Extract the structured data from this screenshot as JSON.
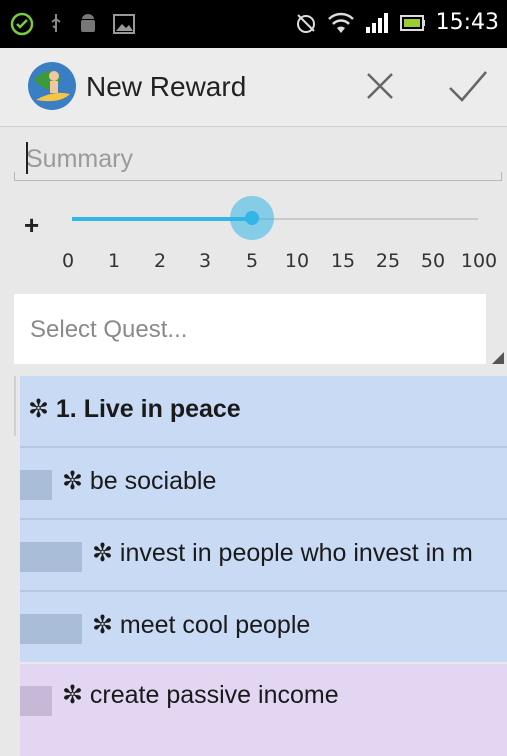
{
  "status_bar": {
    "time": "15:43",
    "icons": [
      "check-circle-icon",
      "usb-icon",
      "android-icon",
      "image-icon",
      "alarm-off-icon",
      "wifi-icon",
      "signal-icon",
      "battery-icon"
    ]
  },
  "action_bar": {
    "title": "New Reward",
    "cancel_icon": "close-icon",
    "done_icon": "check-icon"
  },
  "summary": {
    "placeholder": "Summary",
    "value": ""
  },
  "slider": {
    "prefix": "+",
    "ticks": [
      "0",
      "1",
      "2",
      "3",
      "5",
      "10",
      "15",
      "25",
      "50",
      "100"
    ],
    "selected_value": "5"
  },
  "quest_select": {
    "placeholder": "Select Quest..."
  },
  "dropdown": {
    "items": [
      {
        "label": "✼ 1. Live in peace",
        "bold": true,
        "level": 0,
        "color": "#c9daf5"
      },
      {
        "label": "✼ be sociable",
        "bold": false,
        "level": 1,
        "color": "#c9daf5"
      },
      {
        "label": "✼ invest in people who invest in m",
        "bold": false,
        "level": 2,
        "color": "#c9daf5"
      },
      {
        "label": "✼ meet cool people",
        "bold": false,
        "level": 2,
        "color": "#c9daf5"
      },
      {
        "label": "✼ create passive income",
        "bold": false,
        "level": 1,
        "color": "#e2d6f3"
      }
    ]
  },
  "colors": {
    "accent": "#33b5e5",
    "list_blue": "#c9daf5",
    "list_purple": "#e2d6f3",
    "indent_blue": "#a9bdd8",
    "indent_purple": "#c8b8d8"
  }
}
